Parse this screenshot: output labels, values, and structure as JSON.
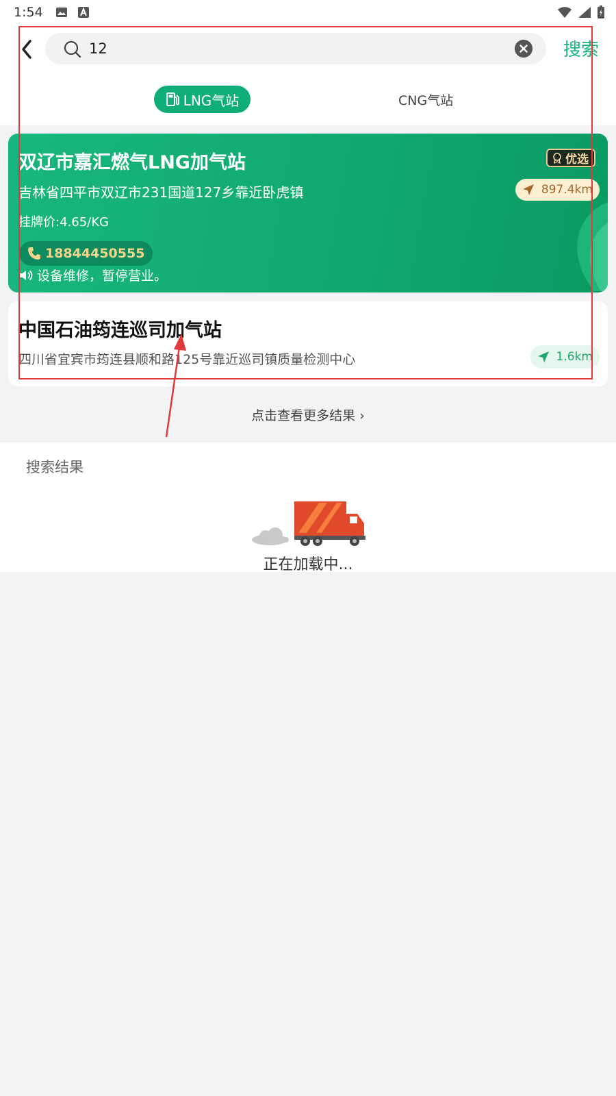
{
  "status_bar": {
    "time": "1:54"
  },
  "search": {
    "value": "12",
    "button_label": "搜索"
  },
  "tabs": [
    {
      "label": "LNG气站",
      "active": true
    },
    {
      "label": "CNG气站",
      "active": false
    }
  ],
  "stations": [
    {
      "name": "双辽市嘉汇燃气LNG加气站",
      "badge": "优选",
      "address": "吉林省四平市双辽市231国道127乡靠近卧虎镇",
      "distance": "897.4km",
      "price": "挂牌价:4.65/KG",
      "phone": "18844450555",
      "notice": "设备维修，暂停营业。"
    },
    {
      "name": "中国石油筠连巡司加气站",
      "address": "四川省宜宾市筠连县顺和路125号靠近巡司镇质量检测中心",
      "distance": "1.6km"
    }
  ],
  "more_results": "点击查看更多结果 ›",
  "results_section": {
    "label": "搜索结果",
    "loading": "正在加载中..."
  },
  "colors": {
    "accent": "#0fae78",
    "annotation": "#e23a3a"
  }
}
